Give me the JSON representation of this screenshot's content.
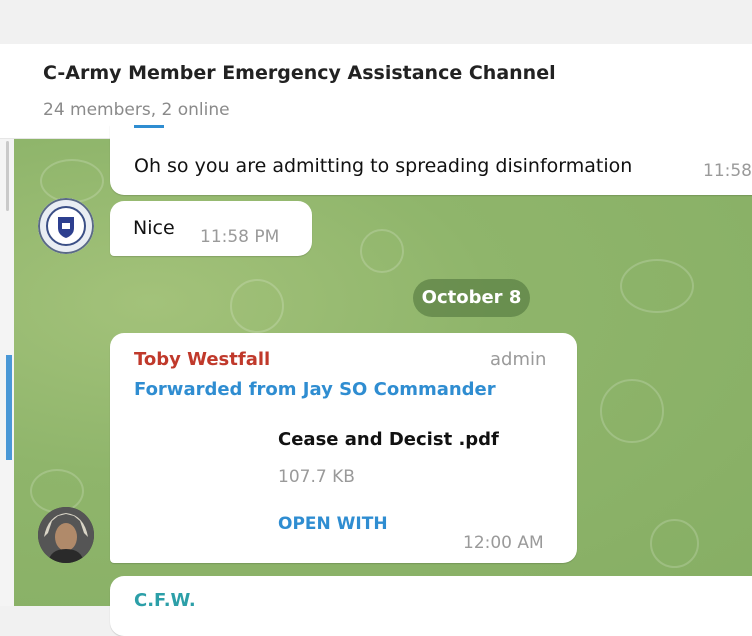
{
  "header": {
    "title": "C-Army Member Emergency Assistance Channel",
    "subtitle": "24 members, 2 online"
  },
  "messages": [
    {
      "text": "Oh so you are admitting to spreading disinformation",
      "time": "11:58"
    },
    {
      "text": "Nice",
      "time": "11:58 PM"
    }
  ],
  "date_divider": "October 8",
  "forward_message": {
    "sender": "Toby Westfall",
    "role": "admin",
    "forwarded_from": "Forwarded from Jay SO Commander",
    "file_name": "Cease and Decist .pdf",
    "file_size": "107.7 KB",
    "open_with_label": "OPEN WITH",
    "time": "12:00 AM"
  },
  "next_message": {
    "sender_partial": "C.F.W."
  },
  "colors": {
    "accent_blue": "#2f8dd1",
    "sender_red": "#c0392b",
    "chat_bg": "#8fb56b"
  }
}
